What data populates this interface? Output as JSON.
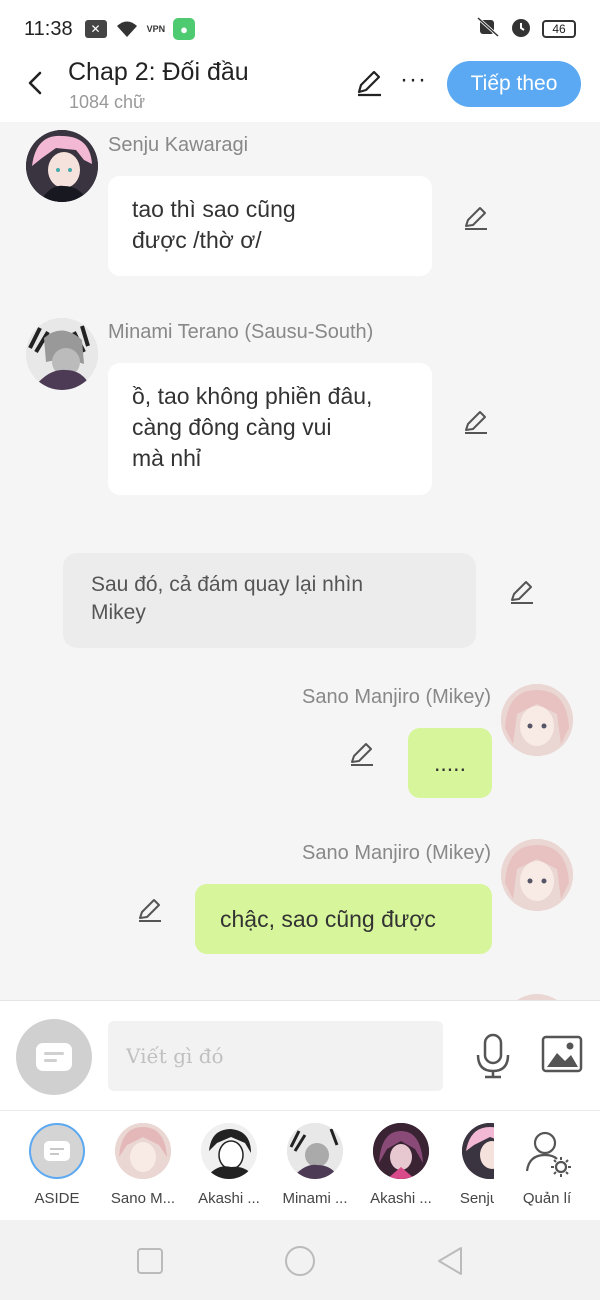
{
  "status_bar": {
    "time": "11:38",
    "vpn_label": "VPN",
    "battery_level": "46"
  },
  "header": {
    "title": "Chap 2: Đối đầu",
    "word_count": "1084 chữ",
    "next_label": "Tiếp theo"
  },
  "messages": [
    {
      "sender": "Senju Kawaragi",
      "text": "tao thì sao cũng\nđược /thờ ơ/"
    },
    {
      "sender": "Minami Terano (Sausu-South)",
      "text": "ồ, tao không phiền đâu,\ncàng đông càng vui\nmà nhỉ"
    },
    {
      "sender": "",
      "text": "Sau đó, cả đám quay lại nhìn\nMikey"
    },
    {
      "sender": "Sano Manjiro (Mikey)",
      "text": "....."
    },
    {
      "sender": "Sano Manjiro (Mikey)",
      "text": "chậc, sao cũng được"
    }
  ],
  "input": {
    "placeholder": "Viết gì đó"
  },
  "characters": [
    {
      "label": "ASIDE"
    },
    {
      "label": "Sano M..."
    },
    {
      "label": "Akashi ..."
    },
    {
      "label": "Minami ..."
    },
    {
      "label": "Akashi ..."
    },
    {
      "label": "Senju"
    },
    {
      "label": "Quản lí"
    }
  ],
  "colors": {
    "accent": "#5aa9f2",
    "self_bubble": "#d7f59a",
    "narration_bubble": "#ececec"
  }
}
